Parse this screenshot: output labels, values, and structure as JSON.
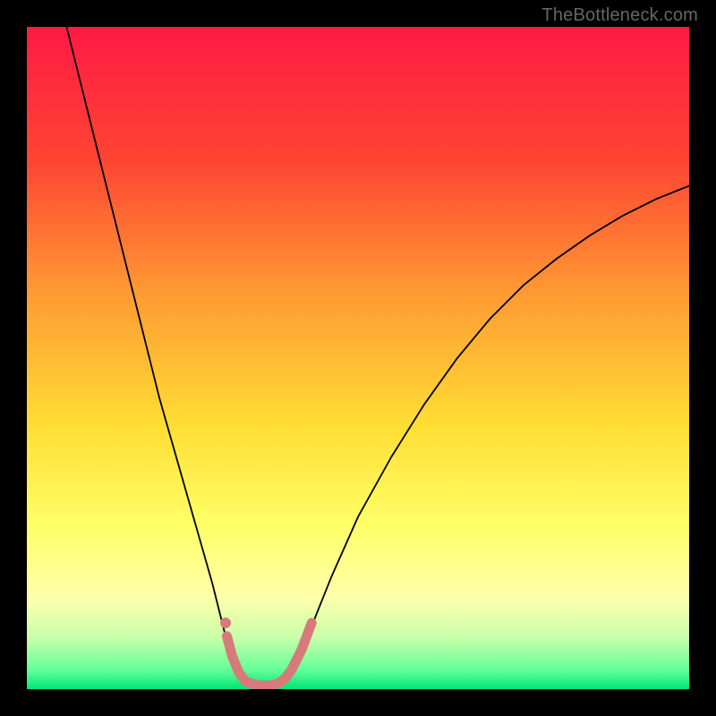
{
  "watermark": "TheBottleneck.com",
  "chart_data": {
    "type": "line",
    "title": "",
    "xlabel": "",
    "ylabel": "",
    "xlim": [
      0,
      100
    ],
    "ylim": [
      0,
      100
    ],
    "background": {
      "type": "vertical-gradient",
      "stops": [
        {
          "offset": 0,
          "color": "#ff1a44"
        },
        {
          "offset": 20,
          "color": "#ff4433"
        },
        {
          "offset": 40,
          "color": "#ff9933"
        },
        {
          "offset": 60,
          "color": "#ffdd33"
        },
        {
          "offset": 75,
          "color": "#ffff66"
        },
        {
          "offset": 86,
          "color": "#ffffaa"
        },
        {
          "offset": 92,
          "color": "#ccffaa"
        },
        {
          "offset": 97,
          "color": "#66ff99"
        },
        {
          "offset": 100,
          "color": "#00e676"
        }
      ]
    },
    "series": [
      {
        "name": "bottleneck-curve",
        "color": "#000000",
        "width": 1.8,
        "points": [
          {
            "x": 6,
            "y": 100
          },
          {
            "x": 8,
            "y": 92
          },
          {
            "x": 10,
            "y": 84
          },
          {
            "x": 12,
            "y": 76
          },
          {
            "x": 14,
            "y": 68
          },
          {
            "x": 16,
            "y": 60
          },
          {
            "x": 18,
            "y": 52
          },
          {
            "x": 20,
            "y": 44
          },
          {
            "x": 22,
            "y": 37
          },
          {
            "x": 24,
            "y": 30
          },
          {
            "x": 26,
            "y": 23
          },
          {
            "x": 28,
            "y": 16
          },
          {
            "x": 29,
            "y": 12
          },
          {
            "x": 30,
            "y": 8
          },
          {
            "x": 31,
            "y": 5
          },
          {
            "x": 32,
            "y": 3
          },
          {
            "x": 33,
            "y": 1.5
          },
          {
            "x": 34,
            "y": 0.8
          },
          {
            "x": 35,
            "y": 0.5
          },
          {
            "x": 36,
            "y": 0.4
          },
          {
            "x": 37,
            "y": 0.5
          },
          {
            "x": 38,
            "y": 0.8
          },
          {
            "x": 39,
            "y": 1.5
          },
          {
            "x": 40,
            "y": 3
          },
          {
            "x": 42,
            "y": 7
          },
          {
            "x": 44,
            "y": 12
          },
          {
            "x": 46,
            "y": 17
          },
          {
            "x": 50,
            "y": 26
          },
          {
            "x": 55,
            "y": 35
          },
          {
            "x": 60,
            "y": 43
          },
          {
            "x": 65,
            "y": 50
          },
          {
            "x": 70,
            "y": 56
          },
          {
            "x": 75,
            "y": 61
          },
          {
            "x": 80,
            "y": 65
          },
          {
            "x": 85,
            "y": 68.5
          },
          {
            "x": 90,
            "y": 71.5
          },
          {
            "x": 95,
            "y": 74
          },
          {
            "x": 100,
            "y": 76
          }
        ]
      },
      {
        "name": "highlight-band",
        "color": "#d87a7a",
        "width": 11,
        "points": [
          {
            "x": 30.2,
            "y": 8
          },
          {
            "x": 31,
            "y": 5
          },
          {
            "x": 32,
            "y": 2.5
          },
          {
            "x": 33,
            "y": 1.2
          },
          {
            "x": 34,
            "y": 0.8
          },
          {
            "x": 35,
            "y": 0.6
          },
          {
            "x": 36,
            "y": 0.5
          },
          {
            "x": 37,
            "y": 0.6
          },
          {
            "x": 38,
            "y": 0.9
          },
          {
            "x": 39,
            "y": 1.6
          },
          {
            "x": 40,
            "y": 3
          },
          {
            "x": 41.5,
            "y": 6
          },
          {
            "x": 43,
            "y": 10
          }
        ]
      },
      {
        "name": "highlight-dot",
        "type": "scatter",
        "color": "#d87a7a",
        "radius": 6,
        "points": [
          {
            "x": 30,
            "y": 10
          }
        ]
      }
    ]
  }
}
